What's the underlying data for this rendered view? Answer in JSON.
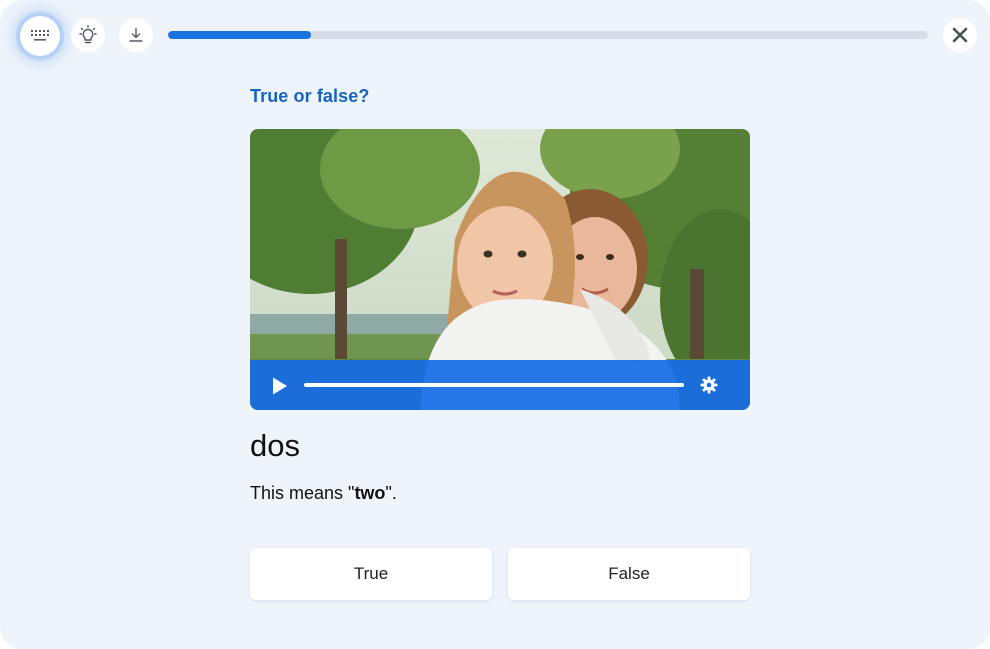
{
  "toolbar": {
    "keyboard_icon": "keyboard-icon",
    "hint_icon": "lightbulb-icon",
    "download_icon": "download-icon",
    "close_icon": "close-icon"
  },
  "progress": {
    "value": 0.188,
    "fill_color": "#1a73e0",
    "track_color": "#d6dde8"
  },
  "question": {
    "title": "True or false?",
    "word": "dos",
    "meaning_prefix": "This means \"",
    "meaning_bold": "two",
    "meaning_suffix": "\"."
  },
  "video": {
    "play_icon": "play-icon",
    "settings_icon": "gear-icon",
    "controls_color": "#166ce6"
  },
  "answers": {
    "true_label": "True",
    "false_label": "False"
  },
  "colors": {
    "accent": "#1565c0",
    "background": "#eff4fb"
  }
}
